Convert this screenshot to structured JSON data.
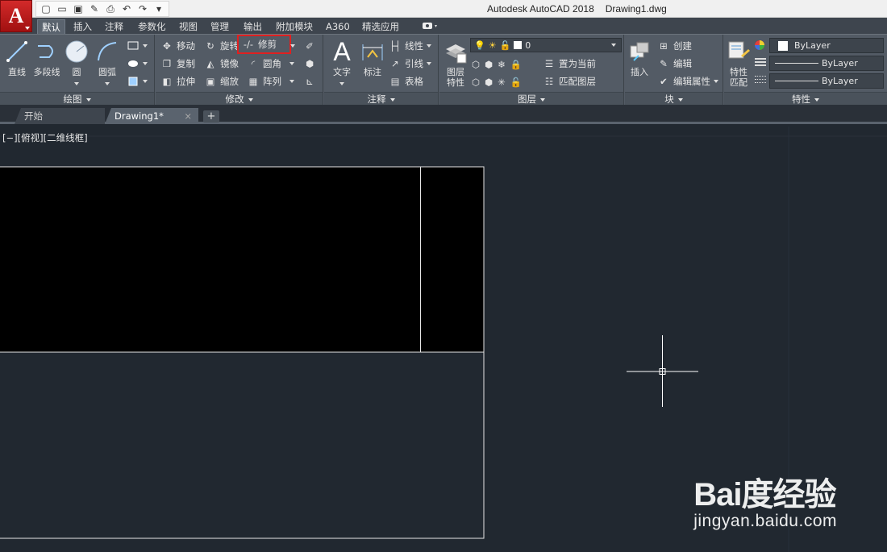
{
  "title_bar": {
    "app_name": "Autodesk AutoCAD 2018",
    "document_name": "Drawing1.dwg"
  },
  "app_logo": {
    "letter": "A"
  },
  "quick_access": [
    "new-icon",
    "open-icon",
    "save-icon",
    "saveas-icon",
    "plot-icon",
    "undo-icon",
    "redo-icon",
    "dropdown-icon"
  ],
  "ribbon_tabs": [
    "默认",
    "插入",
    "注释",
    "参数化",
    "视图",
    "管理",
    "输出",
    "附加模块",
    "A360",
    "精选应用"
  ],
  "active_tab": "默认",
  "panels": {
    "draw": {
      "title": "绘图",
      "line": "直线",
      "polyline": "多段线",
      "circle": "圆",
      "arc": "圆弧"
    },
    "modify": {
      "title": "修改",
      "move": "移动",
      "rotate": "旋转",
      "trim": "修剪",
      "copy": "复制",
      "mirror": "镜像",
      "fillet": "圆角",
      "stretch": "拉伸",
      "scale": "缩放",
      "array": "阵列"
    },
    "annotation": {
      "title": "注释",
      "text": "文字",
      "dimension": "标注",
      "linear": "线性",
      "leader": "引线",
      "table": "表格"
    },
    "layers": {
      "title": "图层",
      "layer_properties": "图层\n特性",
      "current_layer": "0",
      "make_current": "置为当前",
      "match_layer": "匹配图层"
    },
    "block": {
      "title": "块",
      "insert": "插入",
      "create": "创建",
      "edit": "编辑",
      "edit_attributes": "编辑属性"
    },
    "properties": {
      "title": "特性",
      "match_properties": "特性\n匹配",
      "color": "ByLayer",
      "linetype": "ByLayer",
      "lineweight": "ByLayer"
    }
  },
  "doc_tabs": {
    "start": "开始",
    "drawing": "Drawing1*",
    "close": "×",
    "new": "+"
  },
  "viewport": {
    "label": "[−][俯视][二维线框]"
  },
  "watermark": {
    "brand": "Bai度经验",
    "url": "jingyan.baidu.com"
  },
  "colors": {
    "model_bg": "#212830",
    "ribbon_bg": "#535b65",
    "highlight": "#e02020",
    "logo_red": "#c81e1e"
  }
}
